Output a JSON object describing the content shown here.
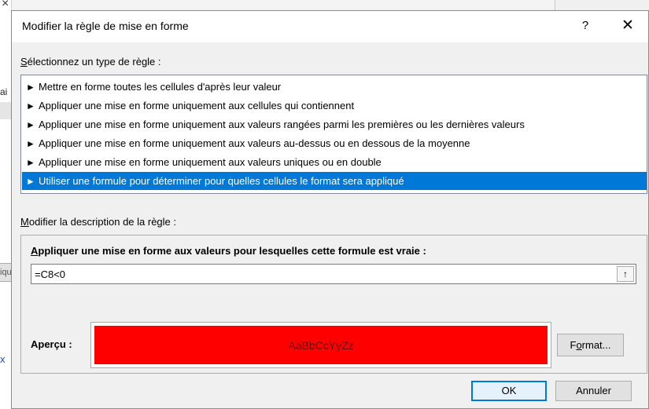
{
  "background": {
    "fragment_text_1": "ai",
    "fragment_btn_text": "ique",
    "fragment_link_text": "x"
  },
  "dialog": {
    "title": "Modifier la règle de mise en forme",
    "help_label": "?",
    "close_label": "✕"
  },
  "rule_type": {
    "label_mnemonic": "S",
    "label_rest": "électionnez un type de règle :",
    "items": [
      {
        "arrow": "►",
        "text": "Mettre en forme toutes les cellules d'après leur valeur",
        "selected": false
      },
      {
        "arrow": "►",
        "text": "Appliquer une mise en forme uniquement aux cellules qui contiennent",
        "selected": false
      },
      {
        "arrow": "►",
        "text": "Appliquer une mise en forme uniquement aux valeurs rangées parmi les premières ou les dernières valeurs",
        "selected": false
      },
      {
        "arrow": "►",
        "text": "Appliquer une mise en forme uniquement aux valeurs au-dessus ou en dessous de la moyenne",
        "selected": false
      },
      {
        "arrow": "►",
        "text": "Appliquer une mise en forme uniquement aux valeurs uniques ou en double",
        "selected": false
      },
      {
        "arrow": "►",
        "text": "Utiliser une formule pour déterminer pour quelles cellules le format sera appliqué",
        "selected": true
      }
    ]
  },
  "description": {
    "label_mnemonic": "M",
    "label_rest": "odifier la description de la règle :",
    "formula_header_mnemonic": "A",
    "formula_header_rest": "ppliquer une mise en forme aux valeurs pour lesquelles cette formule est vraie :",
    "formula_value": "=C8<0",
    "collapse_icon": "↑",
    "preview_label": "Aperçu :",
    "preview_text": "AaBbCcYyZz",
    "preview_fill_color": "#ff0000",
    "format_button_pre": "F",
    "format_button_mnemonic": "o",
    "format_button_post": "rmat..."
  },
  "footer": {
    "ok_label": "OK",
    "cancel_label": "Annuler"
  }
}
